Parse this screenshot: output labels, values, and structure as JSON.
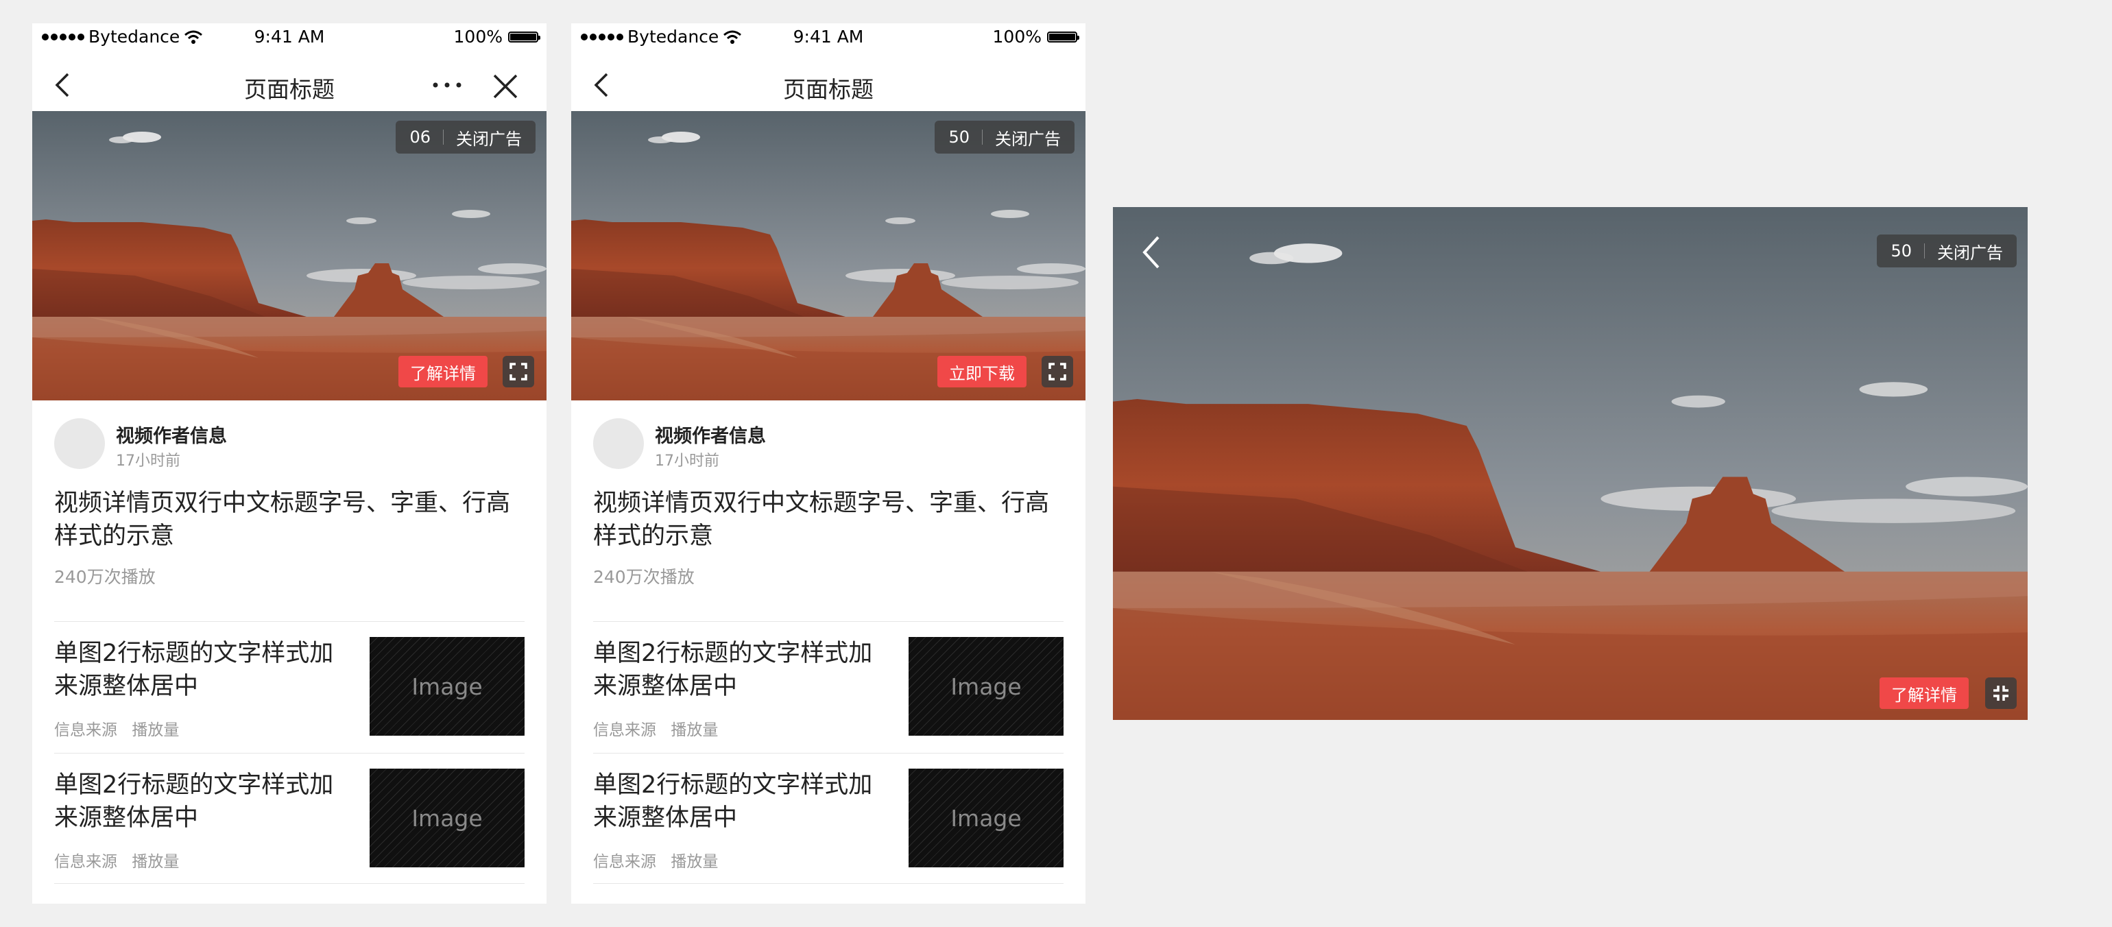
{
  "status_bar": {
    "carrier": "Bytedance",
    "time": "9:41 AM",
    "battery": "100%"
  },
  "screens": [
    {
      "nav": {
        "title": "页面标题"
      },
      "ad": {
        "count": "06",
        "close_label": "关闭广告",
        "cta_label": "了解详情"
      },
      "author": {
        "name": "视频作者信息",
        "time": "17小时前"
      },
      "headline": "视频详情页双行中文标题字号、字重、行高样式的示意",
      "views": "240万次播放",
      "items": [
        {
          "title": "单图2行标题的文字样式加来源整体居中",
          "source": "信息来源",
          "plays": "播放量",
          "thumb_label": "Image"
        },
        {
          "title": "单图2行标题的文字样式加来源整体居中",
          "source": "信息来源",
          "plays": "播放量",
          "thumb_label": "Image"
        }
      ]
    },
    {
      "nav": {
        "title": "页面标题"
      },
      "ad": {
        "count": "50",
        "close_label": "关闭广告",
        "cta_label": "立即下载"
      },
      "author": {
        "name": "视频作者信息",
        "time": "17小时前"
      },
      "headline": "视频详情页双行中文标题字号、字重、行高样式的示意",
      "views": "240万次播放",
      "items": [
        {
          "title": "单图2行标题的文字样式加来源整体居中",
          "source": "信息来源",
          "plays": "播放量",
          "thumb_label": "Image"
        },
        {
          "title": "单图2行标题的文字样式加来源整体居中",
          "source": "信息来源",
          "plays": "播放量",
          "thumb_label": "Image"
        }
      ]
    }
  ],
  "landscape": {
    "ad": {
      "count": "50",
      "close_label": "关闭广告",
      "cta_label": "了解详情"
    }
  },
  "colors": {
    "cta": "#f04848",
    "background": "#f0f0f0"
  },
  "icons": {
    "signal": "signal-dots-icon",
    "wifi": "wifi-icon",
    "battery": "battery-icon",
    "back": "chevron-left-icon",
    "more": "more-dots-icon",
    "close": "close-icon",
    "fullscreen": "fullscreen-icon",
    "exit_fullscreen": "exit-fullscreen-icon"
  }
}
